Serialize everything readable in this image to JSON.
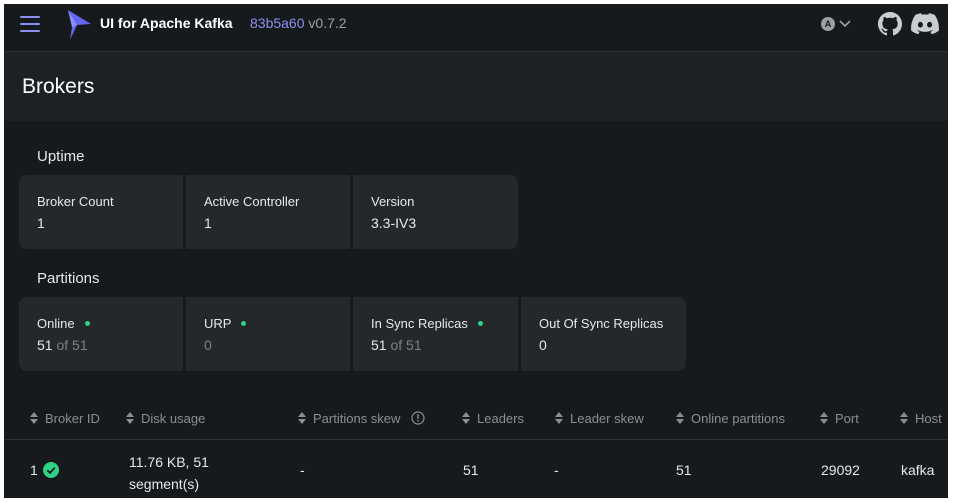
{
  "header": {
    "app_title": "UI for Apache Kafka",
    "commit": "83b5a60",
    "version": "v0.7.2",
    "user_initial": "A",
    "icons": [
      "menu-icon",
      "kafka-logo",
      "chevron-down-icon",
      "github-icon",
      "discord-icon"
    ]
  },
  "page": {
    "title": "Brokers"
  },
  "uptime": {
    "title": "Uptime",
    "cards": [
      {
        "label": "Broker Count",
        "value": "1"
      },
      {
        "label": "Active Controller",
        "value": "1"
      },
      {
        "label": "Version",
        "value": "3.3-IV3"
      }
    ]
  },
  "partitions": {
    "title": "Partitions",
    "cards": [
      {
        "label": "Online",
        "value": "51",
        "of": "of 51"
      },
      {
        "label": "URP",
        "value": "0"
      },
      {
        "label": "In Sync Replicas",
        "value": "51",
        "of": "of 51"
      },
      {
        "label": "Out Of Sync Replicas",
        "value": "0"
      }
    ]
  },
  "table": {
    "columns": [
      "Broker ID",
      "Disk usage",
      "Partitions skew",
      "Leaders",
      "Leader skew",
      "Online partitions",
      "Port",
      "Host"
    ],
    "rows": [
      {
        "broker_id": "1",
        "disk_usage_line1": "11.76 KB, 51",
        "disk_usage_line2": "segment(s)",
        "partitions_skew": "-",
        "leaders": "51",
        "leader_skew": "-",
        "online_partitions": "51",
        "port": "29092",
        "host": "kafka"
      }
    ]
  },
  "colors": {
    "background": "#171a1c",
    "card": "#25282b",
    "accent": "#8c8ff0",
    "status_green": "#2fd186"
  }
}
